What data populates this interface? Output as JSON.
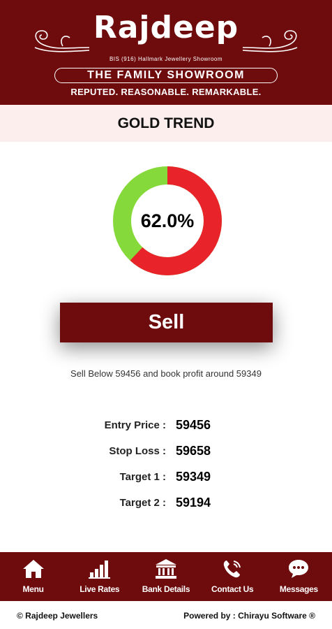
{
  "header": {
    "brand": "Rajdeep",
    "bis_line": "BIS (916) Hallmark Jewellery Showroom",
    "family_line": "THE FAMILY SHOWROOM",
    "tagline": "REPUTED. REASONABLE. REMARKABLE."
  },
  "page_title": "GOLD TREND",
  "trend": {
    "percent_label": "62.0%",
    "sell_fraction": 0.62,
    "colors": {
      "sell": "#e8232a",
      "buy": "#86d93a",
      "brand": "#6e0b0d"
    }
  },
  "action": {
    "label": "Sell",
    "advice": "Sell Below 59456 and book profit around 59349"
  },
  "levels": [
    {
      "label": "Entry Price :",
      "value": "59456"
    },
    {
      "label": "Stop Loss :",
      "value": "59658"
    },
    {
      "label": "Target 1 :",
      "value": "59349"
    },
    {
      "label": "Target 2 :",
      "value": "59194"
    }
  ],
  "nav": [
    {
      "label": "Menu",
      "icon": "home-icon"
    },
    {
      "label": "Live Rates",
      "icon": "bar-chart-icon"
    },
    {
      "label": "Bank Details",
      "icon": "bank-icon"
    },
    {
      "label": "Contact Us",
      "icon": "phone-icon"
    },
    {
      "label": "Messages",
      "icon": "chat-icon"
    }
  ],
  "footer": {
    "copyright": "© Rajdeep Jewellers",
    "powered": "Powered by : Chirayu Software ®"
  }
}
